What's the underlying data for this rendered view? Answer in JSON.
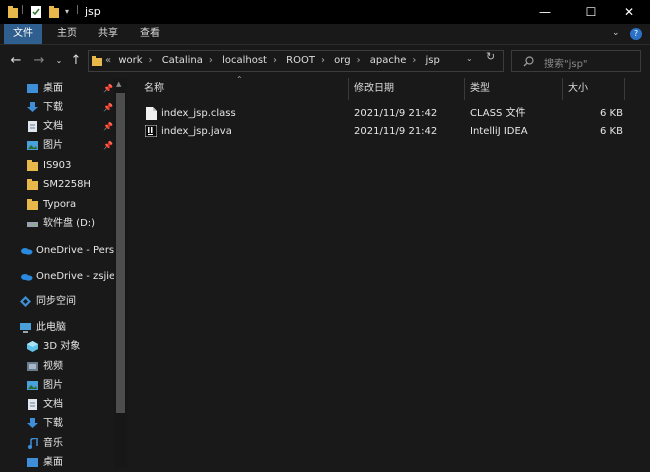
{
  "window": {
    "title": "jsp",
    "controls": [
      "—",
      "☐",
      "✕"
    ]
  },
  "ribbon": {
    "tabs": [
      {
        "label": "文件",
        "active": true
      },
      {
        "label": "主页",
        "active": false
      },
      {
        "label": "共享",
        "active": false
      },
      {
        "label": "查看",
        "active": false
      }
    ]
  },
  "address": {
    "overflow": "«",
    "crumbs": [
      "work",
      "Catalina",
      "localhost",
      "ROOT",
      "org",
      "apache",
      "jsp"
    ]
  },
  "search": {
    "placeholder": "搜索\"jsp\""
  },
  "sidebar": {
    "items": [
      {
        "label": "桌面",
        "icon": "desktop-icon",
        "pinned": true
      },
      {
        "label": "下载",
        "icon": "download-icon",
        "pinned": true
      },
      {
        "label": "文档",
        "icon": "document-icon",
        "pinned": true
      },
      {
        "label": "图片",
        "icon": "picture-icon",
        "pinned": true
      },
      {
        "label": "IS903",
        "icon": "folder-icon"
      },
      {
        "label": "SM2258H",
        "icon": "folder-icon"
      },
      {
        "label": "Typora",
        "icon": "folder-icon"
      },
      {
        "label": "软件盘 (D:)",
        "icon": "drive-icon"
      },
      {
        "label": "OneDrive - Perso",
        "icon": "onedrive-icon"
      },
      {
        "label": "OneDrive - zsjie",
        "icon": "onedrive-icon"
      },
      {
        "label": "同步空间",
        "icon": "sync-icon"
      },
      {
        "label": "此电脑",
        "icon": "computer-icon"
      },
      {
        "label": "3D 对象",
        "icon": "3d-objects-icon"
      },
      {
        "label": "视频",
        "icon": "video-icon"
      },
      {
        "label": "图片",
        "icon": "picture-icon"
      },
      {
        "label": "文档",
        "icon": "document-icon"
      },
      {
        "label": "下载",
        "icon": "download-icon"
      },
      {
        "label": "音乐",
        "icon": "music-icon"
      },
      {
        "label": "桌面",
        "icon": "desktop-icon"
      }
    ]
  },
  "columns": {
    "name": "名称",
    "modified": "修改日期",
    "type": "类型",
    "size": "大小"
  },
  "files": [
    {
      "name": "index_jsp.class",
      "modified": "2021/11/9 21:42",
      "type": "CLASS 文件",
      "size": "6 KB",
      "icon": "class-file-icon"
    },
    {
      "name": "index_jsp.java",
      "modified": "2021/11/9 21:42",
      "type": "IntelliJ IDEA",
      "size": "6 KB",
      "icon": "intellij-file-icon"
    }
  ],
  "colors": {
    "accent": "#2e5f8f",
    "folder": "#e8b94a",
    "onedrive": "#2a8ae0"
  }
}
